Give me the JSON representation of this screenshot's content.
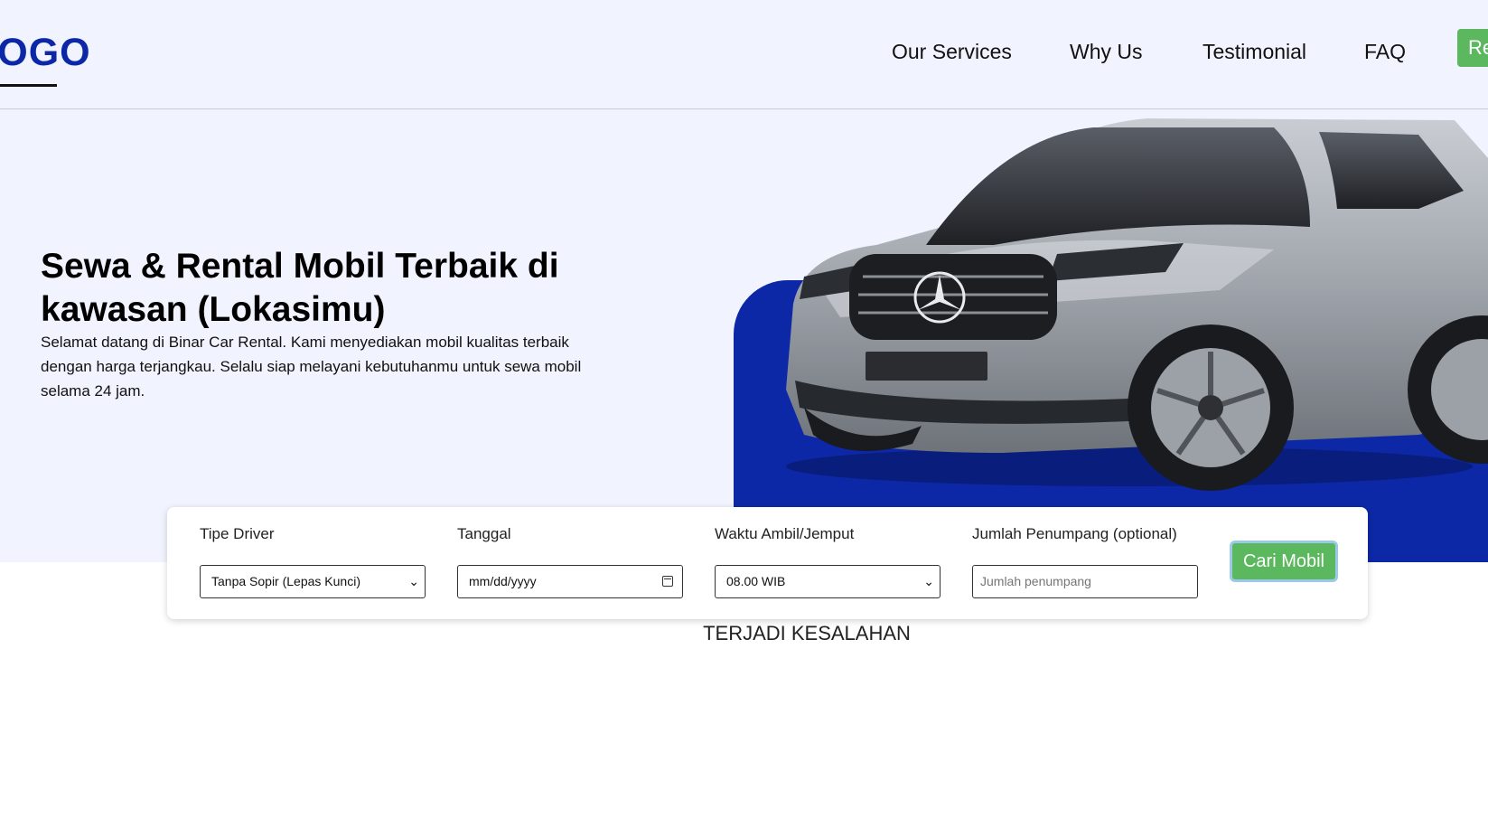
{
  "header": {
    "logo": "LOGO",
    "nav": [
      "Our Services",
      "Why Us",
      "Testimonial",
      "FAQ"
    ],
    "register_label": "Register"
  },
  "hero": {
    "title": "Sewa & Rental Mobil Terbaik di kawasan (Lokasimu)",
    "description": "Selamat datang di Binar Car Rental. Kami menyediakan mobil kualitas terbaik dengan harga terjangkau. Selalu siap melayani kebutuhanmu untuk sewa mobil selama 24 jam."
  },
  "search": {
    "driver_label": "Tipe Driver",
    "driver_value": "Tanpa Sopir (Lepas Kunci)",
    "date_label": "Tanggal",
    "date_placeholder": "mm/dd/yyyy",
    "time_label": "Waktu Ambil/Jemput",
    "time_value": "08.00 WIB",
    "passenger_label": "Jumlah Penumpang (optional)",
    "passenger_placeholder": "Jumlah penumpang",
    "submit_label": "Cari Mobil"
  },
  "status": {
    "error": "TERJADI KESALAHAN"
  },
  "colors": {
    "brand": "#0d28a6",
    "accent": "#5cb85f",
    "hero_bg": "#f1f3fe"
  },
  "icons": {
    "chevron": "chevron-down-icon",
    "calendar": "calendar-icon"
  }
}
